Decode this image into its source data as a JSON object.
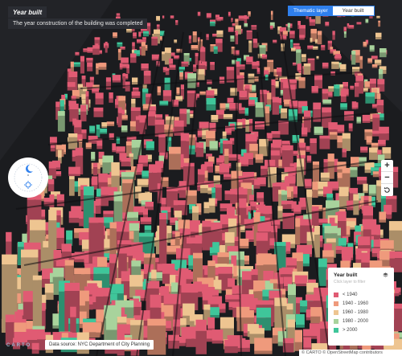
{
  "header": {
    "title": "Year built",
    "subtitle": "The year construction of the building was completed"
  },
  "layer_toggle": {
    "options": [
      "Thematic layer",
      "Year built"
    ],
    "active": "Thematic layer"
  },
  "legend": {
    "title": "Year built",
    "hint": "Click layer to filter",
    "items": [
      {
        "label": "< 1940",
        "color": "#e05b73"
      },
      {
        "label": "1940 - 1960",
        "color": "#ef9a7c"
      },
      {
        "label": "1960 - 1980",
        "color": "#eec591"
      },
      {
        "label": "1980 - 2000",
        "color": "#a8d39c"
      },
      {
        "label": "> 2000",
        "color": "#3fc69a"
      }
    ]
  },
  "zoom": {
    "in_label": "+",
    "out_label": "−"
  },
  "footer": {
    "logo": "CARTO",
    "source": "Data source: NYC Department of City Planning",
    "attribution": "© CARTO © OpenStreetMap contributors"
  },
  "colors": {
    "background": "#1b1c1f",
    "street": "#0e0f11",
    "accent": "#2f80ed"
  }
}
